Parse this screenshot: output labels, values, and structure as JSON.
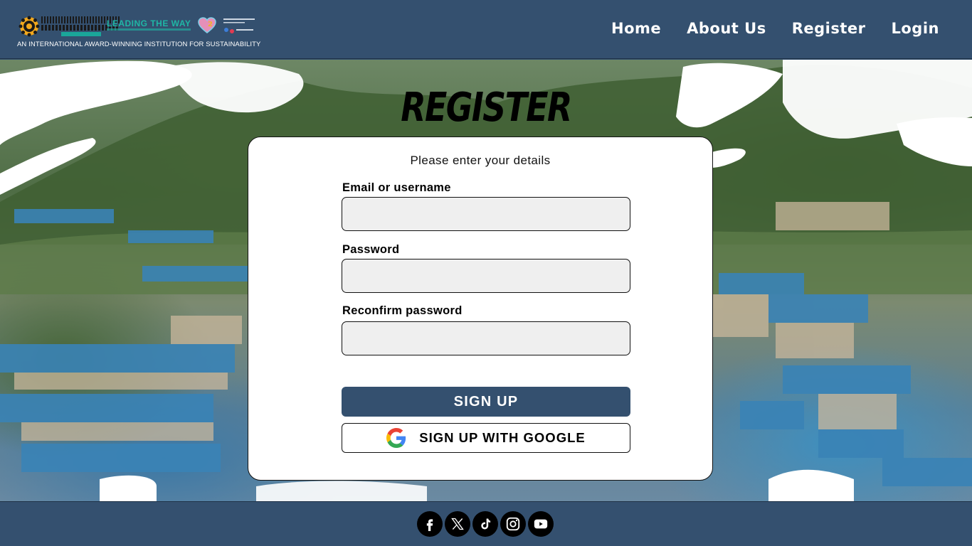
{
  "header": {
    "logo": {
      "lead_text": "LEADING THE WAY",
      "tagline": "AN INTERNATIONAL AWARD-WINNING INSTITUTION FOR SUSTAINABILITY"
    },
    "nav": [
      {
        "label": "Home"
      },
      {
        "label": "About Us"
      },
      {
        "label": "Register"
      },
      {
        "label": "Login"
      }
    ]
  },
  "main": {
    "title": "REGISTER",
    "form": {
      "subtitle": "Please enter your details",
      "fields": [
        {
          "label": "Email or username",
          "value": ""
        },
        {
          "label": "Password",
          "value": ""
        },
        {
          "label": "Reconfirm password",
          "value": ""
        }
      ],
      "signup_label": "SIGN UP",
      "google_label": "SIGN UP WITH GOOGLE"
    }
  },
  "footer": {
    "socials": [
      {
        "icon": "facebook-icon"
      },
      {
        "icon": "x-icon"
      },
      {
        "icon": "tiktok-icon"
      },
      {
        "icon": "instagram-icon"
      },
      {
        "icon": "youtube-icon"
      }
    ]
  },
  "colors": {
    "brand": "#34506f",
    "card_bg": "#ffffff",
    "input_bg": "#efefef",
    "teal": "#1fb6a5"
  }
}
